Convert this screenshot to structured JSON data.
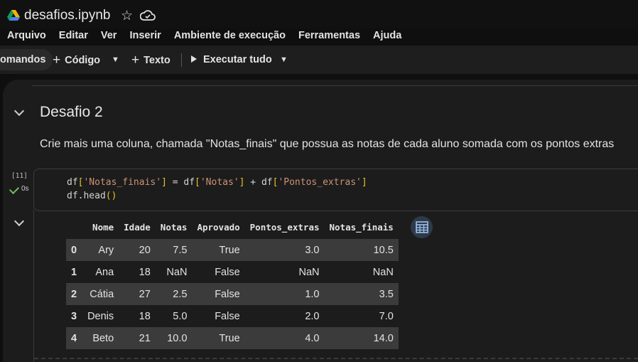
{
  "app": {
    "title": "desafios.ipynb"
  },
  "menu": [
    "Arquivo",
    "Editar",
    "Ver",
    "Inserir",
    "Ambiente de execução",
    "Ferramentas",
    "Ajuda"
  ],
  "toolbar": {
    "palette_label": "omandos",
    "code_label": "Código",
    "text_label": "Texto",
    "run_all_label": "Executar tudo"
  },
  "section": {
    "heading": "Desafio 2",
    "description": "Crie mais uma coluna, chamada \"Notas_finais\" que possua as notas de cada aluno somada com os pontos extras"
  },
  "cell": {
    "execution_count": "[11]",
    "exec_time": "0s",
    "code_line_2": "df.head()"
  },
  "output_table": {
    "columns": [
      "",
      "Nome",
      "Idade",
      "Notas",
      "Aprovado",
      "Pontos_extras",
      "Notas_finais"
    ],
    "rows": [
      [
        "0",
        "Ary",
        "20",
        "7.5",
        "True",
        "3.0",
        "10.5"
      ],
      [
        "1",
        "Ana",
        "18",
        "NaN",
        "False",
        "NaN",
        "NaN"
      ],
      [
        "2",
        "Cátia",
        "27",
        "2.5",
        "False",
        "1.0",
        "3.5"
      ],
      [
        "3",
        "Denis",
        "18",
        "5.0",
        "False",
        "2.0",
        "7.0"
      ],
      [
        "4",
        "Beto",
        "21",
        "10.0",
        "True",
        "4.0",
        "14.0"
      ]
    ]
  },
  "colors": {
    "background": "#0f0f0f",
    "panel": "#1c1c1c",
    "string": "#ce9178",
    "bracket": "#e6c229",
    "success": "#6bbf59"
  }
}
